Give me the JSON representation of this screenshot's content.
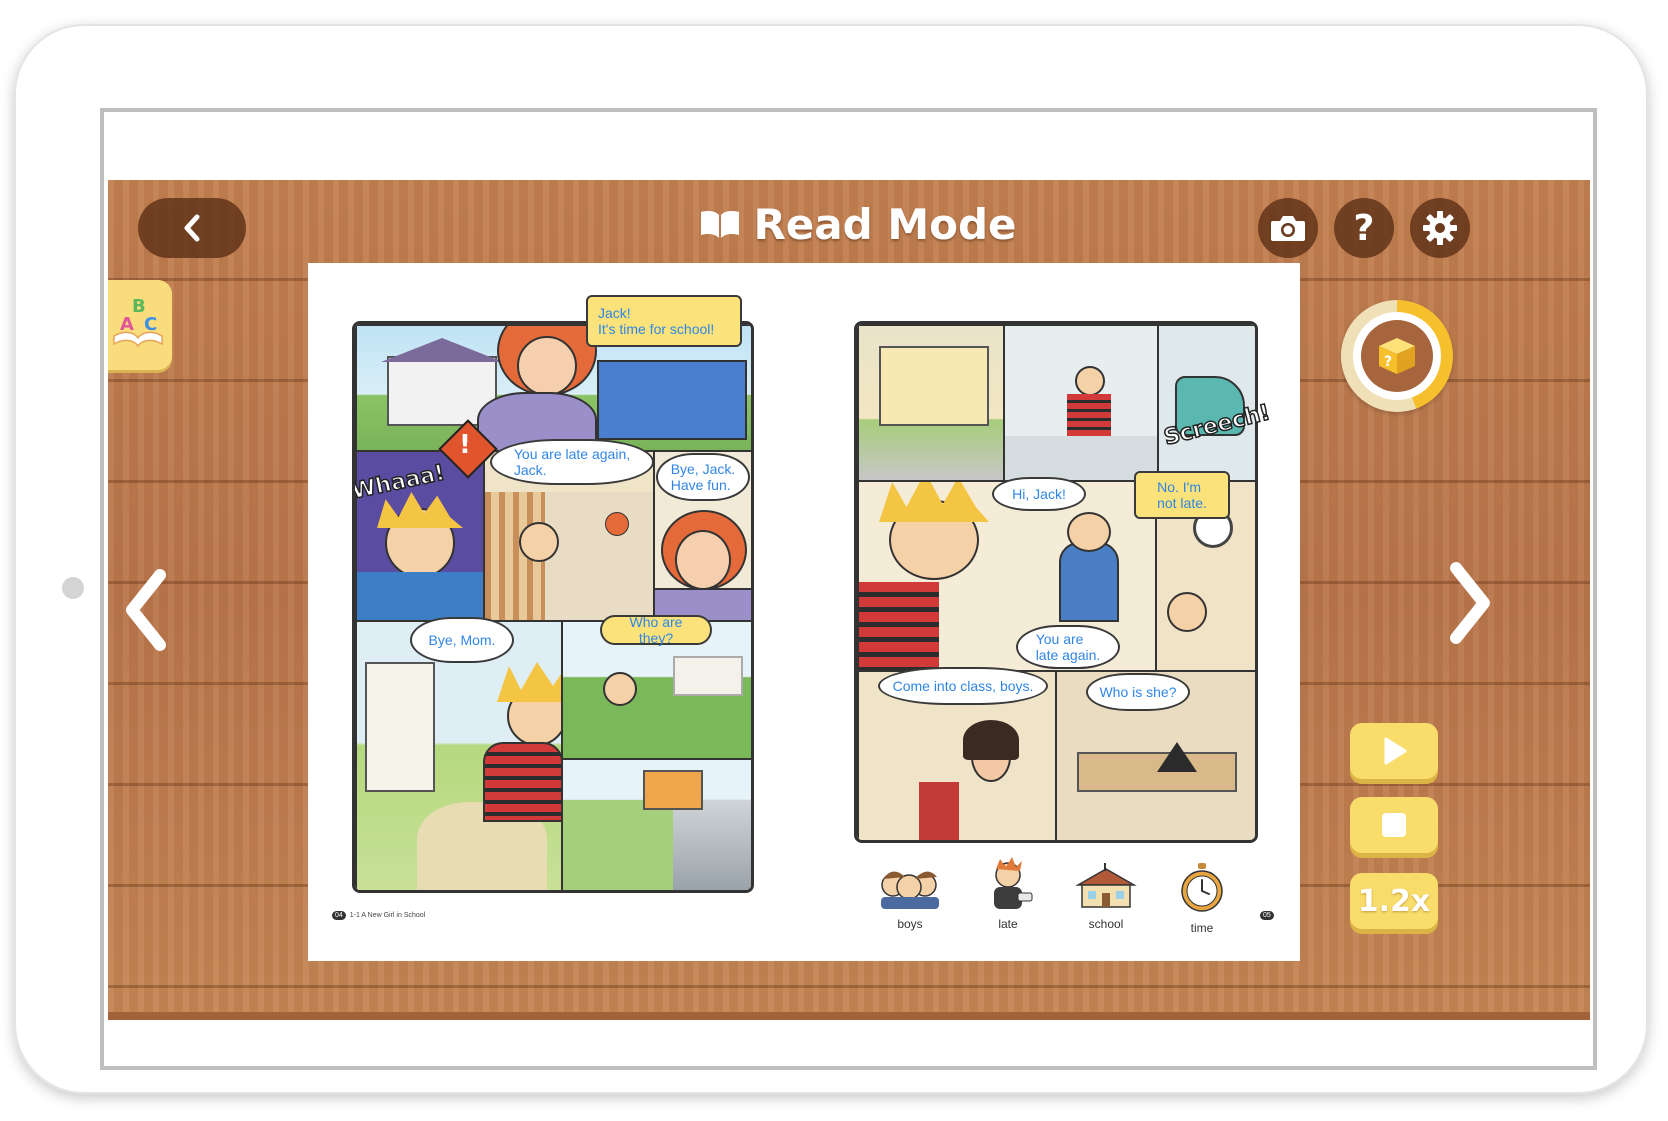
{
  "header": {
    "title": "Read Mode",
    "back_icon": "chevron-left-icon",
    "title_icon": "open-book-icon",
    "actions": [
      {
        "name": "camera-button",
        "icon": "camera-icon"
      },
      {
        "name": "help-button",
        "icon": "question-mark-icon",
        "glyph": "?"
      },
      {
        "name": "settings-button",
        "icon": "gear-icon"
      }
    ]
  },
  "sidebar": {
    "abc_tab_icon": "abc-book-icon",
    "abc_letters": [
      "A",
      "B",
      "C"
    ]
  },
  "quiz": {
    "icon": "mystery-box-icon",
    "glyph": "?",
    "progress": 0.45
  },
  "controls": {
    "play_icon": "play-icon",
    "stop_icon": "stop-icon",
    "speed_label": "1.2x"
  },
  "book": {
    "left_page": {
      "number": "04",
      "footer": "1-1 A New Girl in School",
      "bubbles": {
        "jack_time": "Jack!\nIt's time for school!",
        "late_again": "You are late again,\nJack.",
        "bye_jack": "Bye, Jack.\nHave fun.",
        "bye_mom": "Bye, Mom.",
        "who_are_they": "Who are they?"
      },
      "sfx": {
        "whaaa": "Whaaa!",
        "exclaim": "!"
      }
    },
    "right_page": {
      "number": "05",
      "bubbles": {
        "hi_jack": "Hi, Jack!",
        "no_im_not_late": "No. I'm\nnot late.",
        "you_are_late_again": "You are\nlate again.",
        "come_into_class": "Come into class, boys.",
        "who_is_she": "Who is she?"
      },
      "sfx": {
        "screech": "Screech!"
      },
      "vocabulary": [
        {
          "word": "boys",
          "icon": "boys-icon"
        },
        {
          "word": "late",
          "icon": "late-boy-icon"
        },
        {
          "word": "school",
          "icon": "school-icon"
        },
        {
          "word": "time",
          "icon": "clock-icon"
        }
      ]
    }
  },
  "navigation": {
    "prev_icon": "chevron-left-icon",
    "next_icon": "chevron-right-icon"
  },
  "colors": {
    "wood": "#c27f4f",
    "button_dark": "#5c3016",
    "bubble_text": "#2f86e6",
    "yellow_button": "#f9dd6a",
    "quiz_ring": "#f6c02d"
  }
}
